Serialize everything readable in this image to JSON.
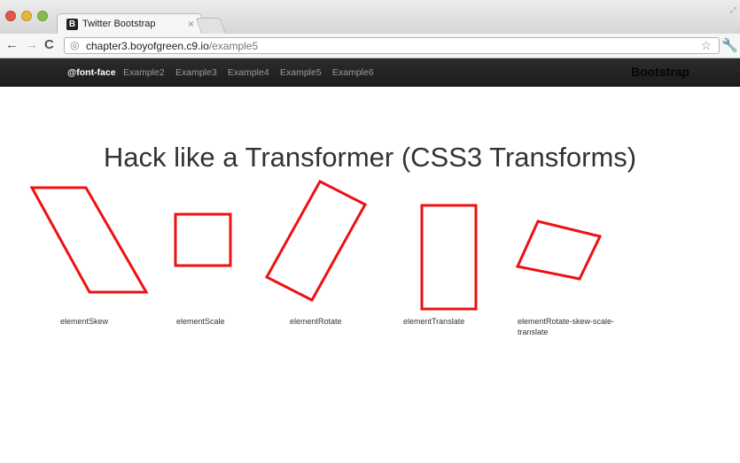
{
  "browser": {
    "tab_title": "Twitter Bootstrap",
    "tab_favicon_letter": "B",
    "tab_close": "×",
    "url_host": "chapter3.boyofgreen.c9.io",
    "url_path": "/example5",
    "back": "←",
    "forward": "→",
    "reload": "C",
    "star": "☆",
    "wrench": "🔧",
    "secure_icon": "◎"
  },
  "navbar": {
    "items": [
      "@font-face",
      "Example2",
      "Example3",
      "Example4",
      "Example5",
      "Example6"
    ],
    "active_index": 0,
    "brand": "Bootstrap"
  },
  "main": {
    "heading": "Hack like a Transformer (CSS3 Transforms)",
    "captions": [
      "elementSkew",
      "elementScale",
      "elementRotate",
      "elementTranslate",
      "elementRotate-skew-scale-translate"
    ],
    "shape_color": "#ee1111"
  }
}
